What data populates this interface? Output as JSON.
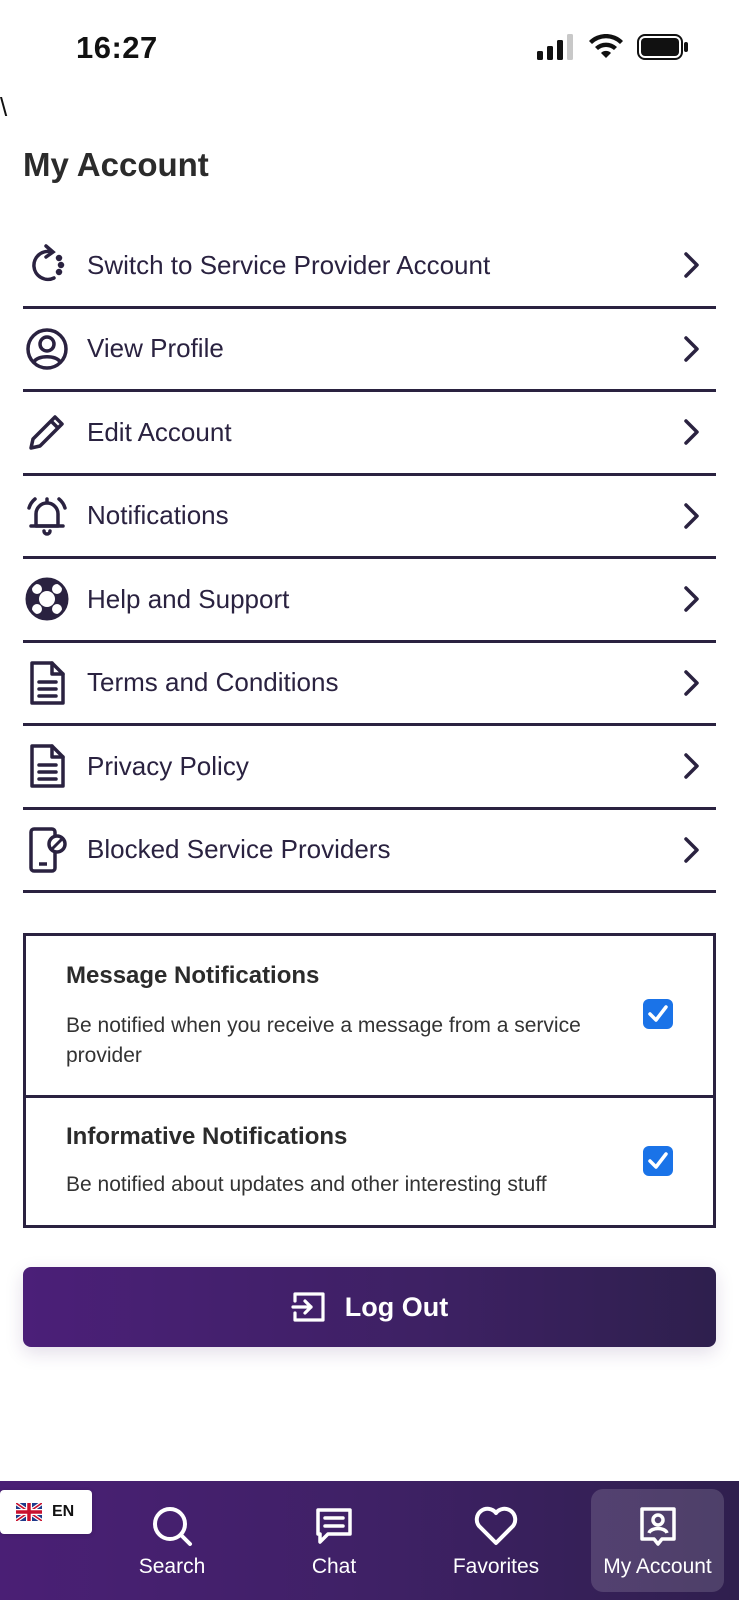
{
  "status_bar": {
    "time": "16:27"
  },
  "stray_text": "\\",
  "page": {
    "title": "My Account"
  },
  "menu": {
    "items": [
      {
        "label": "Switch to Service Provider Account",
        "icon": "switch-account-icon"
      },
      {
        "label": "View Profile",
        "icon": "user-circle-icon"
      },
      {
        "label": "Edit Account",
        "icon": "pencil-icon"
      },
      {
        "label": "Notifications",
        "icon": "bell-icon"
      },
      {
        "label": "Help and Support",
        "icon": "lifebuoy-icon"
      },
      {
        "label": "Terms and Conditions",
        "icon": "document-icon"
      },
      {
        "label": "Privacy Policy",
        "icon": "document-icon"
      },
      {
        "label": "Blocked Service Providers",
        "icon": "blocked-device-icon"
      }
    ]
  },
  "notifications": {
    "message": {
      "title": "Message Notifications",
      "description": "Be notified when you receive a message from a service provider",
      "checked": true
    },
    "informative": {
      "title": "Informative Notifications",
      "description": "Be notified about updates and other interesting stuff",
      "checked": true
    }
  },
  "logout": {
    "label": "Log Out"
  },
  "language": {
    "code": "EN",
    "icon": "uk-flag-icon"
  },
  "bottom_nav": {
    "items": [
      {
        "label": "Search",
        "icon": "search-icon"
      },
      {
        "label": "Chat",
        "icon": "chat-icon"
      },
      {
        "label": "Favorites",
        "icon": "heart-icon"
      },
      {
        "label": "My Account",
        "icon": "account-badge-icon",
        "active": true
      }
    ]
  },
  "colors": {
    "primary": "#2a2240",
    "accent_gradient_start": "#4b1f78",
    "accent_gradient_end": "#2e1f4d",
    "checkbox": "#1a73e8"
  }
}
